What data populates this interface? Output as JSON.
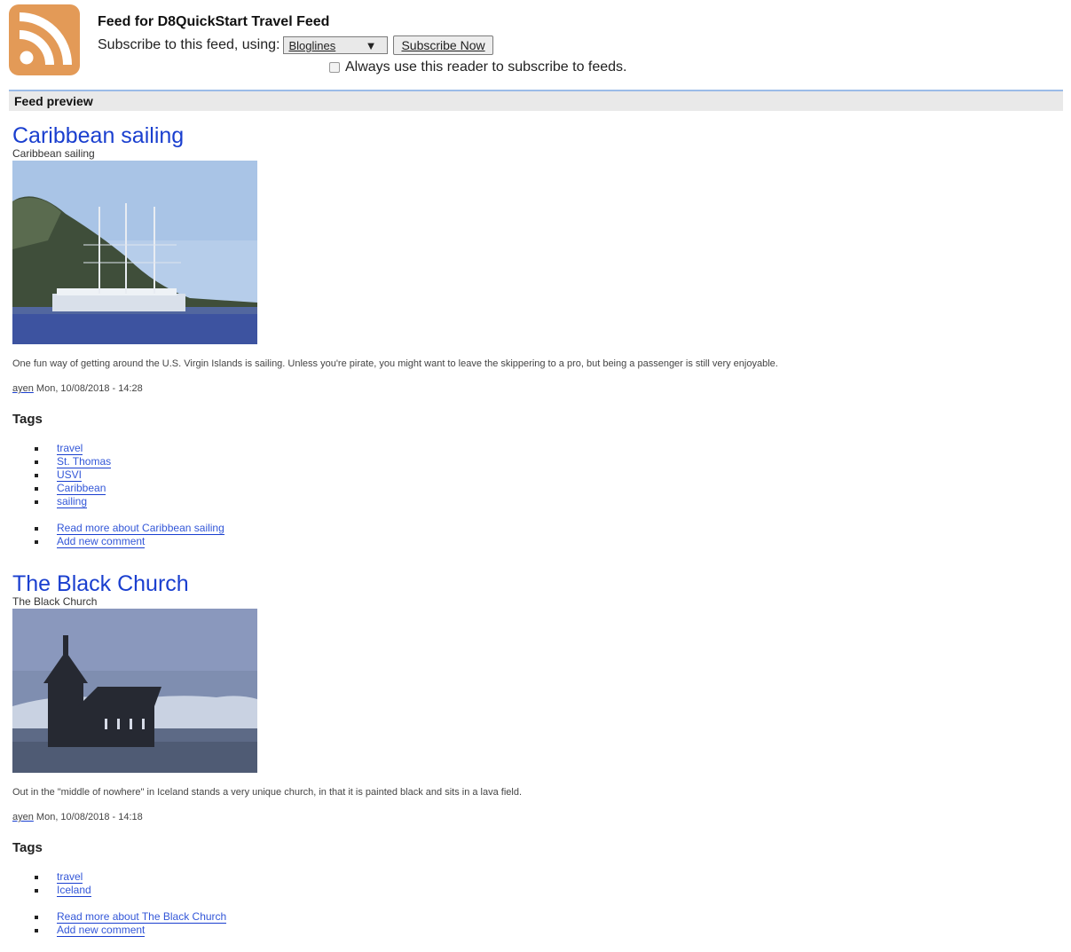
{
  "header": {
    "title": "Feed for D8QuickStart Travel Feed",
    "subscribe_prompt": "Subscribe to this feed, using:",
    "reader_selected": "Bloglines",
    "reader_arrow": "▼",
    "subscribe_button": "Subscribe Now",
    "always_use_label": "Always use this reader to subscribe to feeds."
  },
  "preview_label": "Feed preview",
  "colors": {
    "rss_orange": "#e39a57",
    "link_blue": "#1a3fcf",
    "preview_border": "#9bbbe8"
  },
  "entries": [
    {
      "title": "Caribbean sailing",
      "subtitle": "Caribbean sailing",
      "body": "One fun way of getting around the U.S. Virgin Islands is sailing. Unless you're pirate, you might want to leave the skippering to a pro, but being a passenger is still very enjoyable.",
      "author": "ayen",
      "date": "Mon, 10/08/2018 - 14:28",
      "tags_heading": "Tags",
      "tags": [
        "travel",
        "St. Thomas",
        "USVI",
        "Caribbean",
        "sailing"
      ],
      "read_more": "Read more about Caribbean sailing",
      "add_comment": "Add new comment"
    },
    {
      "title": "The Black Church",
      "subtitle": "The Black Church",
      "body": "Out in the \"middle of nowhere\" in Iceland stands a very unique church, in that it is painted black and sits in a lava field.",
      "author": "ayen",
      "date": "Mon, 10/08/2018 - 14:18",
      "tags_heading": "Tags",
      "tags": [
        "travel",
        "Iceland"
      ],
      "read_more": "Read more about The Black Church",
      "add_comment": "Add new comment"
    }
  ]
}
